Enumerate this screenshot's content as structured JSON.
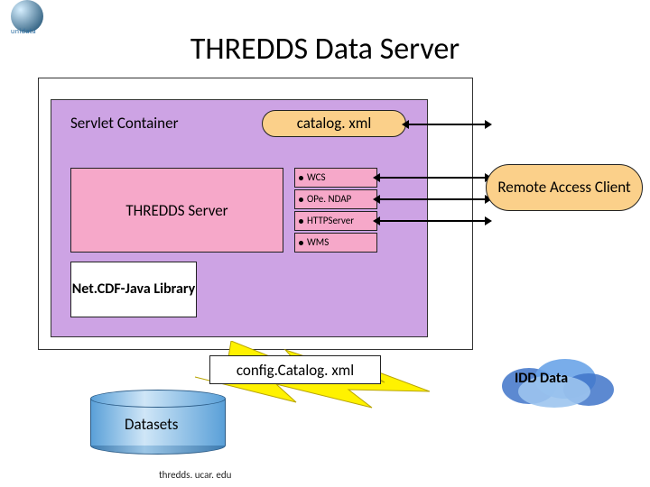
{
  "logo": {
    "brand": "unidata"
  },
  "title": "THREDDS Data Server",
  "servlet_label": "Servlet Container",
  "catalog_box": "catalog. xml",
  "thredds_box": "THREDDS Server",
  "services": {
    "wcs": "WCS",
    "opendap": "OPe. NDAP",
    "http": "HTTPServer",
    "wms": "WMS"
  },
  "netcdf_box": "Net.CDF-Java Library",
  "remote_box": "Remote Access Client",
  "config_box": "config.Catalog. xml",
  "idd_label": "IDD Data",
  "datasets_label": "Datasets",
  "footer": "thredds. ucar. edu"
}
